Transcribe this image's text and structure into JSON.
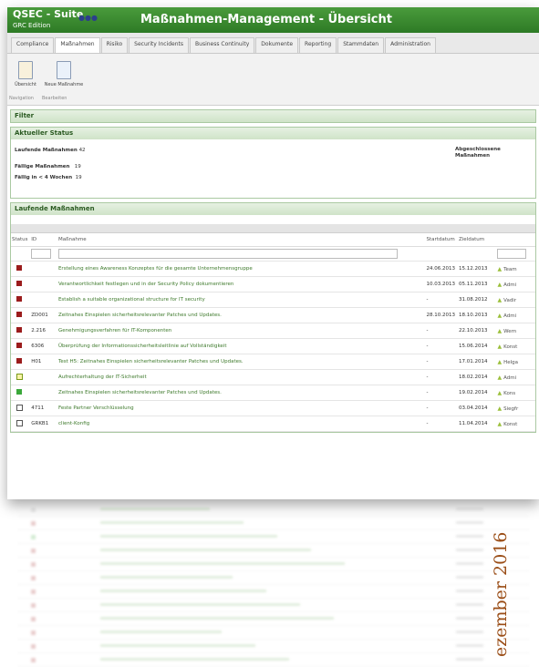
{
  "header": {
    "app_name": "QSEC - Suite",
    "edition": "GRC Edition",
    "badge": "●●●",
    "title": "Maßnahmen-Management - Übersicht"
  },
  "tabs": [
    "Compliance",
    "Maßnahmen",
    "Risiko",
    "Security Incidents",
    "Business Continuity",
    "Dokumente",
    "Reporting",
    "Stammdaten",
    "Administration"
  ],
  "active_tab": "Maßnahmen",
  "ribbon": {
    "buttons": [
      "Übersicht",
      "Neue Maßnahme"
    ],
    "groups": [
      "Navigation",
      "Bearbeiten"
    ]
  },
  "filter": {
    "title": "Filter"
  },
  "status": {
    "title": "Aktueller Status",
    "running_label": "Laufende Maßnahmen",
    "running_value": "42",
    "due_label": "Fällige Maßnahmen",
    "due_value": "19",
    "due4_label": "Fällig in < 4 Wochen",
    "due4_value": "19",
    "closed_label": "Abgeschlossene Maßnahmen"
  },
  "table": {
    "title": "Laufende Maßnahmen",
    "columns": [
      "Status",
      "ID",
      "Maßnahme",
      "Startdatum",
      "Zieldatum"
    ],
    "rows": [
      {
        "status": "red",
        "id": "",
        "measure": "Erstellung eines Awareness Konzeptes für die gesamte Unternehmensgruppe",
        "start": "24.06.2013",
        "target": "15.12.2013",
        "user": "Team"
      },
      {
        "status": "red",
        "id": "",
        "measure": "Verantwortlichkeit festlegen und in der Security Policy dokumentieren",
        "start": "10.03.2013",
        "target": "05.11.2013",
        "user": "Admi"
      },
      {
        "status": "red",
        "id": "",
        "measure": "Establish a suitable organizational structure for IT security",
        "start": "-",
        "target": "31.08.2012",
        "user": "Vadir"
      },
      {
        "status": "red",
        "id": "ZD001",
        "measure": "Zeitnahes Einspielen sicherheitsrelevanter Patches und Updates.",
        "start": "28.10.2013",
        "target": "18.10.2013",
        "user": "Admi"
      },
      {
        "status": "red",
        "id": "2.216",
        "measure": "Genehmigungsverfahren für IT-Komponenten",
        "start": "-",
        "target": "22.10.2013",
        "user": "Wern"
      },
      {
        "status": "red",
        "id": "6306",
        "measure": "Überprüfung der Informationssicherheitsleitlinie auf Vollständigkeit",
        "start": "-",
        "target": "15.06.2014",
        "user": "Konst"
      },
      {
        "status": "red",
        "id": "H01",
        "measure": "Test H5: Zeitnahes Einspielen sicherheitsrelevanter Patches und Updates.",
        "start": "-",
        "target": "17.01.2014",
        "user": "Helga"
      },
      {
        "status": "yellow",
        "id": "",
        "measure": "Aufrechterhaltung der IT-Sicherheit",
        "start": "-",
        "target": "18.02.2014",
        "user": "Admi"
      },
      {
        "status": "green",
        "id": "",
        "measure": "Zeitnahes Einspielen sicherheitsrelevanter Patches und Updates.",
        "start": "-",
        "target": "19.02.2014",
        "user": "Kons"
      },
      {
        "status": "empty",
        "id": "4711",
        "measure": "Feste Partner Verschlüsselung",
        "start": "-",
        "target": "03.04.2014",
        "user": "Siegfr"
      },
      {
        "status": "empty",
        "id": "GRKB1",
        "measure": "client-Konfig",
        "start": "-",
        "target": "11.04.2014",
        "user": "Konst"
      }
    ]
  },
  "caption": "ezember 2016"
}
